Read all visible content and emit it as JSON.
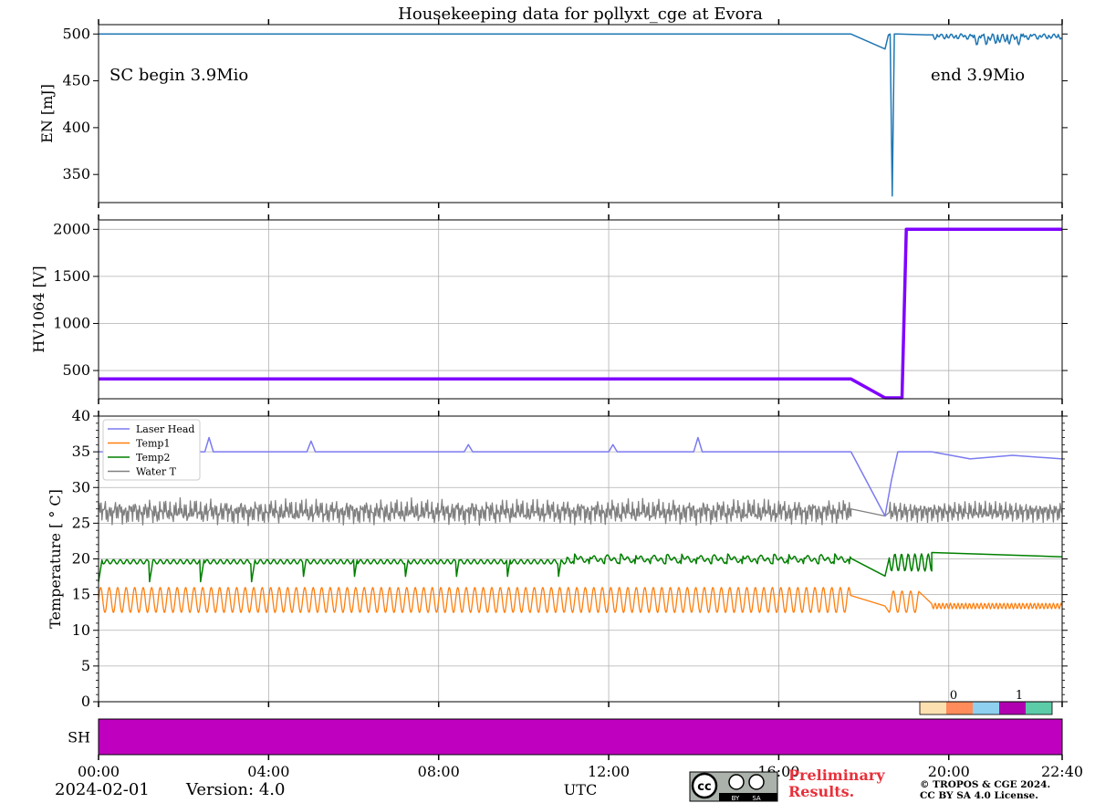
{
  "chart_data": [
    {
      "type": "line",
      "title": "Housekeeping data for pollyxt_cge at Evora",
      "ylabel": "EN [mJ]",
      "ylim": [
        320,
        510
      ],
      "yticks": [
        350,
        400,
        450,
        500
      ],
      "grid": false,
      "annotations": [
        "SC begin 3.9Mio",
        "end 3.9Mio"
      ],
      "series": [
        {
          "color": "#1f77b4",
          "x": [
            0,
            17.7,
            18.5,
            18.58,
            18.62,
            18.67,
            18.72,
            18.8,
            19.6,
            19.7,
            19.9,
            20.2,
            20.5,
            20.8,
            21.1,
            21.4,
            21.6,
            21.9,
            22.2,
            22.4,
            22.67
          ],
          "y": [
            500,
            500,
            484,
            499,
            500,
            327,
            500,
            500,
            499,
            496,
            499,
            492,
            499,
            488,
            498,
            491,
            499,
            490,
            498,
            493,
            499
          ]
        }
      ]
    },
    {
      "type": "line",
      "ylabel": "HV1064 [V]",
      "ylim": [
        200,
        2100
      ],
      "yticks": [
        500,
        1000,
        1500,
        2000
      ],
      "grid": true,
      "series": [
        {
          "color": "#7f00ff",
          "x": [
            0,
            17.7,
            18.5,
            18.7,
            18.9,
            19.0,
            22.67
          ],
          "y": [
            410,
            410,
            210,
            210,
            210,
            2000,
            2000
          ]
        }
      ]
    },
    {
      "type": "line",
      "ylabel": "Temperature [$^\\circ C$]",
      "ylim": [
        0,
        40
      ],
      "yticks": [
        0,
        5,
        10,
        15,
        20,
        25,
        30,
        35,
        40
      ],
      "grid": true,
      "legend_position": "top-left",
      "series": [
        {
          "name": "Laser Head",
          "color": "#7b7bf0",
          "x": [
            0,
            2.5,
            2.6,
            2.7,
            4.9,
            5.0,
            5.1,
            8.6,
            8.7,
            8.8,
            12.0,
            12.1,
            12.2,
            14.0,
            14.1,
            14.2,
            17.7,
            18.5,
            18.65,
            18.8,
            19.2,
            19.6,
            20.5,
            21.5,
            22.67
          ],
          "y": [
            35,
            35,
            37,
            35,
            35,
            36.5,
            35,
            35,
            36,
            35,
            35,
            36,
            35,
            35,
            37,
            35,
            35,
            26,
            31,
            35,
            35,
            35,
            34,
            34.5,
            34
          ]
        },
        {
          "name": "Temp1",
          "color": "#ff7f0e",
          "pattern": "oscillating",
          "min": 12.5,
          "max": 16,
          "tail_x": [
            19.6,
            22.67
          ],
          "tail_y": [
            13.5,
            13.5
          ]
        },
        {
          "name": "Temp2",
          "color": "#008000",
          "pattern": "sawtooth_dips",
          "base": 20,
          "dip": 17,
          "tail_x": [
            19.6,
            22.67
          ],
          "tail_y": [
            20.3,
            20.3
          ]
        },
        {
          "name": "Water T",
          "color": "#808080",
          "pattern": "noisy",
          "min": 24.5,
          "max": 28.5,
          "tail_x": [
            17.7,
            18.5
          ],
          "tail_y": [
            27,
            26
          ]
        }
      ]
    },
    {
      "type": "heatmap",
      "ylabel": "SH",
      "color": "#bf00bf",
      "colorbar_ticks": [
        "0",
        "1"
      ],
      "colorbar_colors": [
        "#fde0b0",
        "#ff8c5a",
        "#8fd0f0",
        "#b000b0",
        "#5ccba8"
      ],
      "xlabel": "UTC",
      "xticks": [
        "00:00",
        "04:00",
        "08:00",
        "12:00",
        "16:00",
        "20:00",
        "22:40"
      ],
      "xlim_hours": [
        0,
        22.67
      ]
    }
  ],
  "footer": {
    "date": "2024-02-01",
    "version": "Version: 4.0",
    "preliminary": [
      "Preliminary",
      "Results."
    ],
    "copyright": [
      "© TROPOS & CGE 2024.",
      "CC BY SA 4.0 License."
    ],
    "license_badge": {
      "cc": "cc",
      "by": "BY",
      "sa": "SA"
    }
  }
}
